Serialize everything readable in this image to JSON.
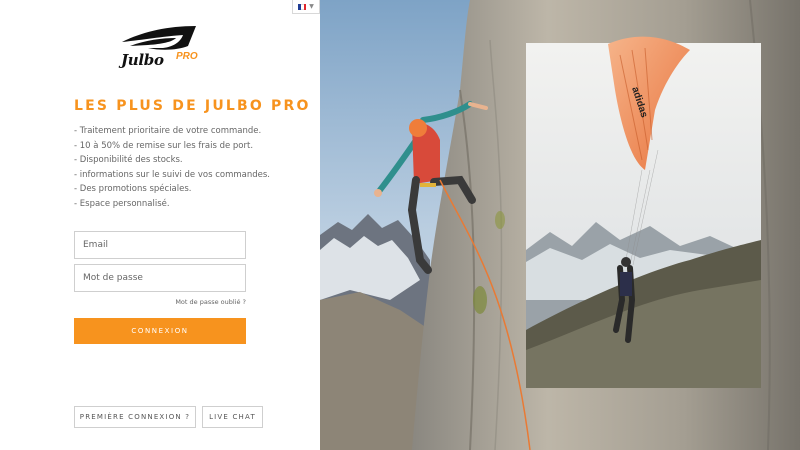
{
  "language": {
    "code": "FR",
    "flag_colors": [
      "#1f3c94",
      "#ffffff",
      "#e1262d"
    ]
  },
  "brand": {
    "name": "Julbo",
    "suffix": "PRO",
    "accent": "#f7931e"
  },
  "benefits": {
    "title": "LES PLUS DE JULBO PRO",
    "items": [
      "- Traitement prioritaire de votre commande.",
      "- 10 à 50% de remise sur les frais de port.",
      "- Disponibilité des stocks.",
      "- informations sur le suivi de vos commandes.",
      "- Des promotions spéciales.",
      "- Espace personnalisé."
    ]
  },
  "login": {
    "email_placeholder": "Email",
    "password_placeholder": "Mot de passe",
    "forgot_label": "Mot de passe oublié ?",
    "submit_label": "CONNEXION"
  },
  "footer": {
    "first_login_label": "PREMIÈRE CONNEXION ?",
    "live_chat_label": "LIVE CHAT"
  },
  "hero": {
    "paraglider_text": "adidas"
  }
}
